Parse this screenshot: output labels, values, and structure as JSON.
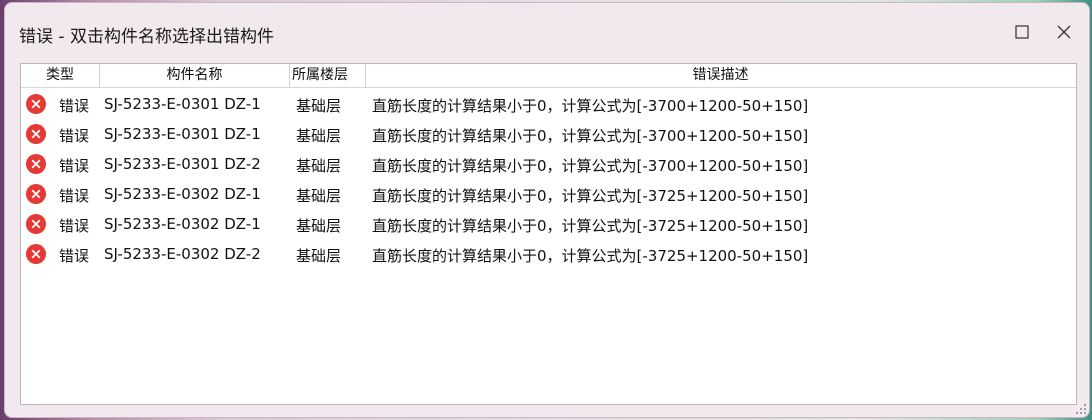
{
  "window": {
    "title": "错误 - 双击构件名称选择出错构件"
  },
  "icons": {
    "maximize": "maximize-icon",
    "close": "close-icon",
    "error": "error-circle-icon",
    "resize": "resize-grip-icon"
  },
  "colors": {
    "error_red": "#e53935",
    "window_bg": "#f2e9ef"
  },
  "table": {
    "columns": [
      "类型",
      "构件名称",
      "所属楼层",
      "错误描述"
    ],
    "rows": [
      {
        "type": "错误",
        "name": "SJ-5233-E-0301 DZ-1",
        "floor": "基础层",
        "desc": "直筋长度的计算结果小于0，计算公式为[-3700+1200-50+150]"
      },
      {
        "type": "错误",
        "name": "SJ-5233-E-0301 DZ-1",
        "floor": "基础层",
        "desc": "直筋长度的计算结果小于0，计算公式为[-3700+1200-50+150]"
      },
      {
        "type": "错误",
        "name": "SJ-5233-E-0301 DZ-2",
        "floor": "基础层",
        "desc": "直筋长度的计算结果小于0，计算公式为[-3700+1200-50+150]"
      },
      {
        "type": "错误",
        "name": "SJ-5233-E-0302 DZ-1",
        "floor": "基础层",
        "desc": "直筋长度的计算结果小于0，计算公式为[-3725+1200-50+150]"
      },
      {
        "type": "错误",
        "name": "SJ-5233-E-0302 DZ-1",
        "floor": "基础层",
        "desc": "直筋长度的计算结果小于0，计算公式为[-3725+1200-50+150]"
      },
      {
        "type": "错误",
        "name": "SJ-5233-E-0302 DZ-2",
        "floor": "基础层",
        "desc": "直筋长度的计算结果小于0，计算公式为[-3725+1200-50+150]"
      }
    ]
  }
}
